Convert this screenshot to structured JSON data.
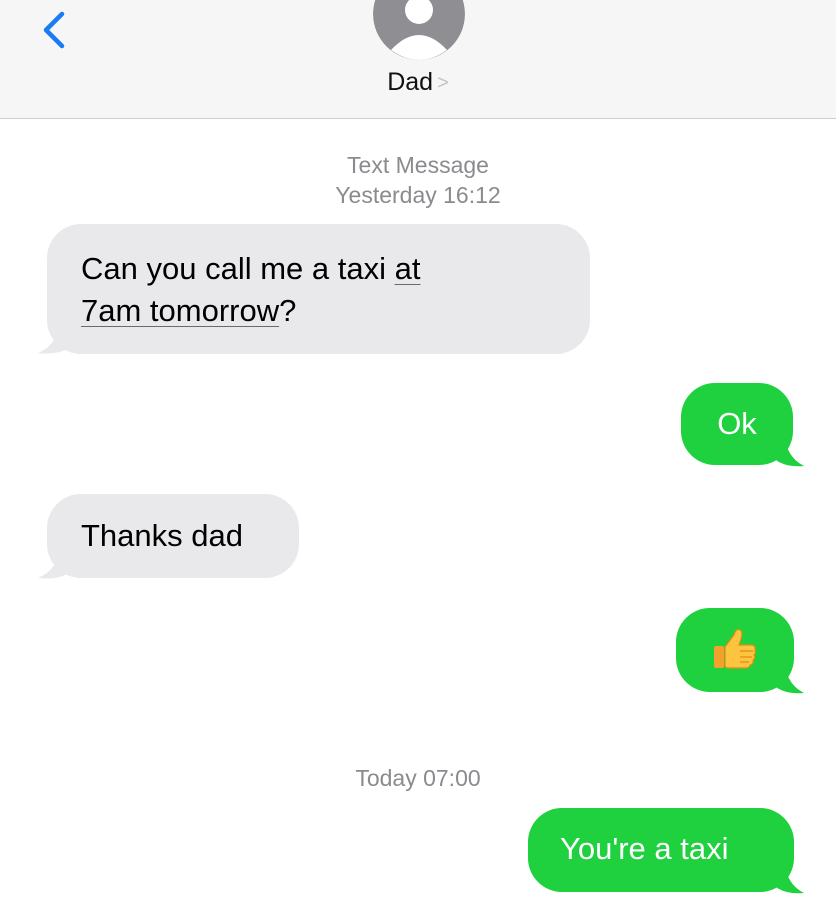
{
  "header": {
    "contact_name": "Dad",
    "contact_chevron": ">",
    "back_icon": "chevron-left-icon",
    "avatar_icon": "person-avatar-icon"
  },
  "thread": {
    "timestamps": [
      {
        "service": "Text Message",
        "time": "Yesterday 16:12"
      },
      {
        "time": "Today 07:00"
      }
    ],
    "messages": [
      {
        "direction": "incoming",
        "line1_pre": "Can you call me a taxi ",
        "line1_link": "at",
        "line2_link": "7am tomorrow",
        "line2_post": "?"
      },
      {
        "direction": "outgoing",
        "text": "Ok"
      },
      {
        "direction": "incoming",
        "text": "Thanks dad"
      },
      {
        "direction": "outgoing",
        "emoji": "thumbs-up-icon"
      },
      {
        "direction": "outgoing",
        "text": "You're a taxi"
      }
    ]
  },
  "colors": {
    "incoming_bubble": "#e9e9eb",
    "outgoing_bubble": "#1fd03f",
    "ios_blue": "#1a7cf5",
    "header_bg": "#f6f6f6",
    "timestamp": "#8b8b8f"
  }
}
